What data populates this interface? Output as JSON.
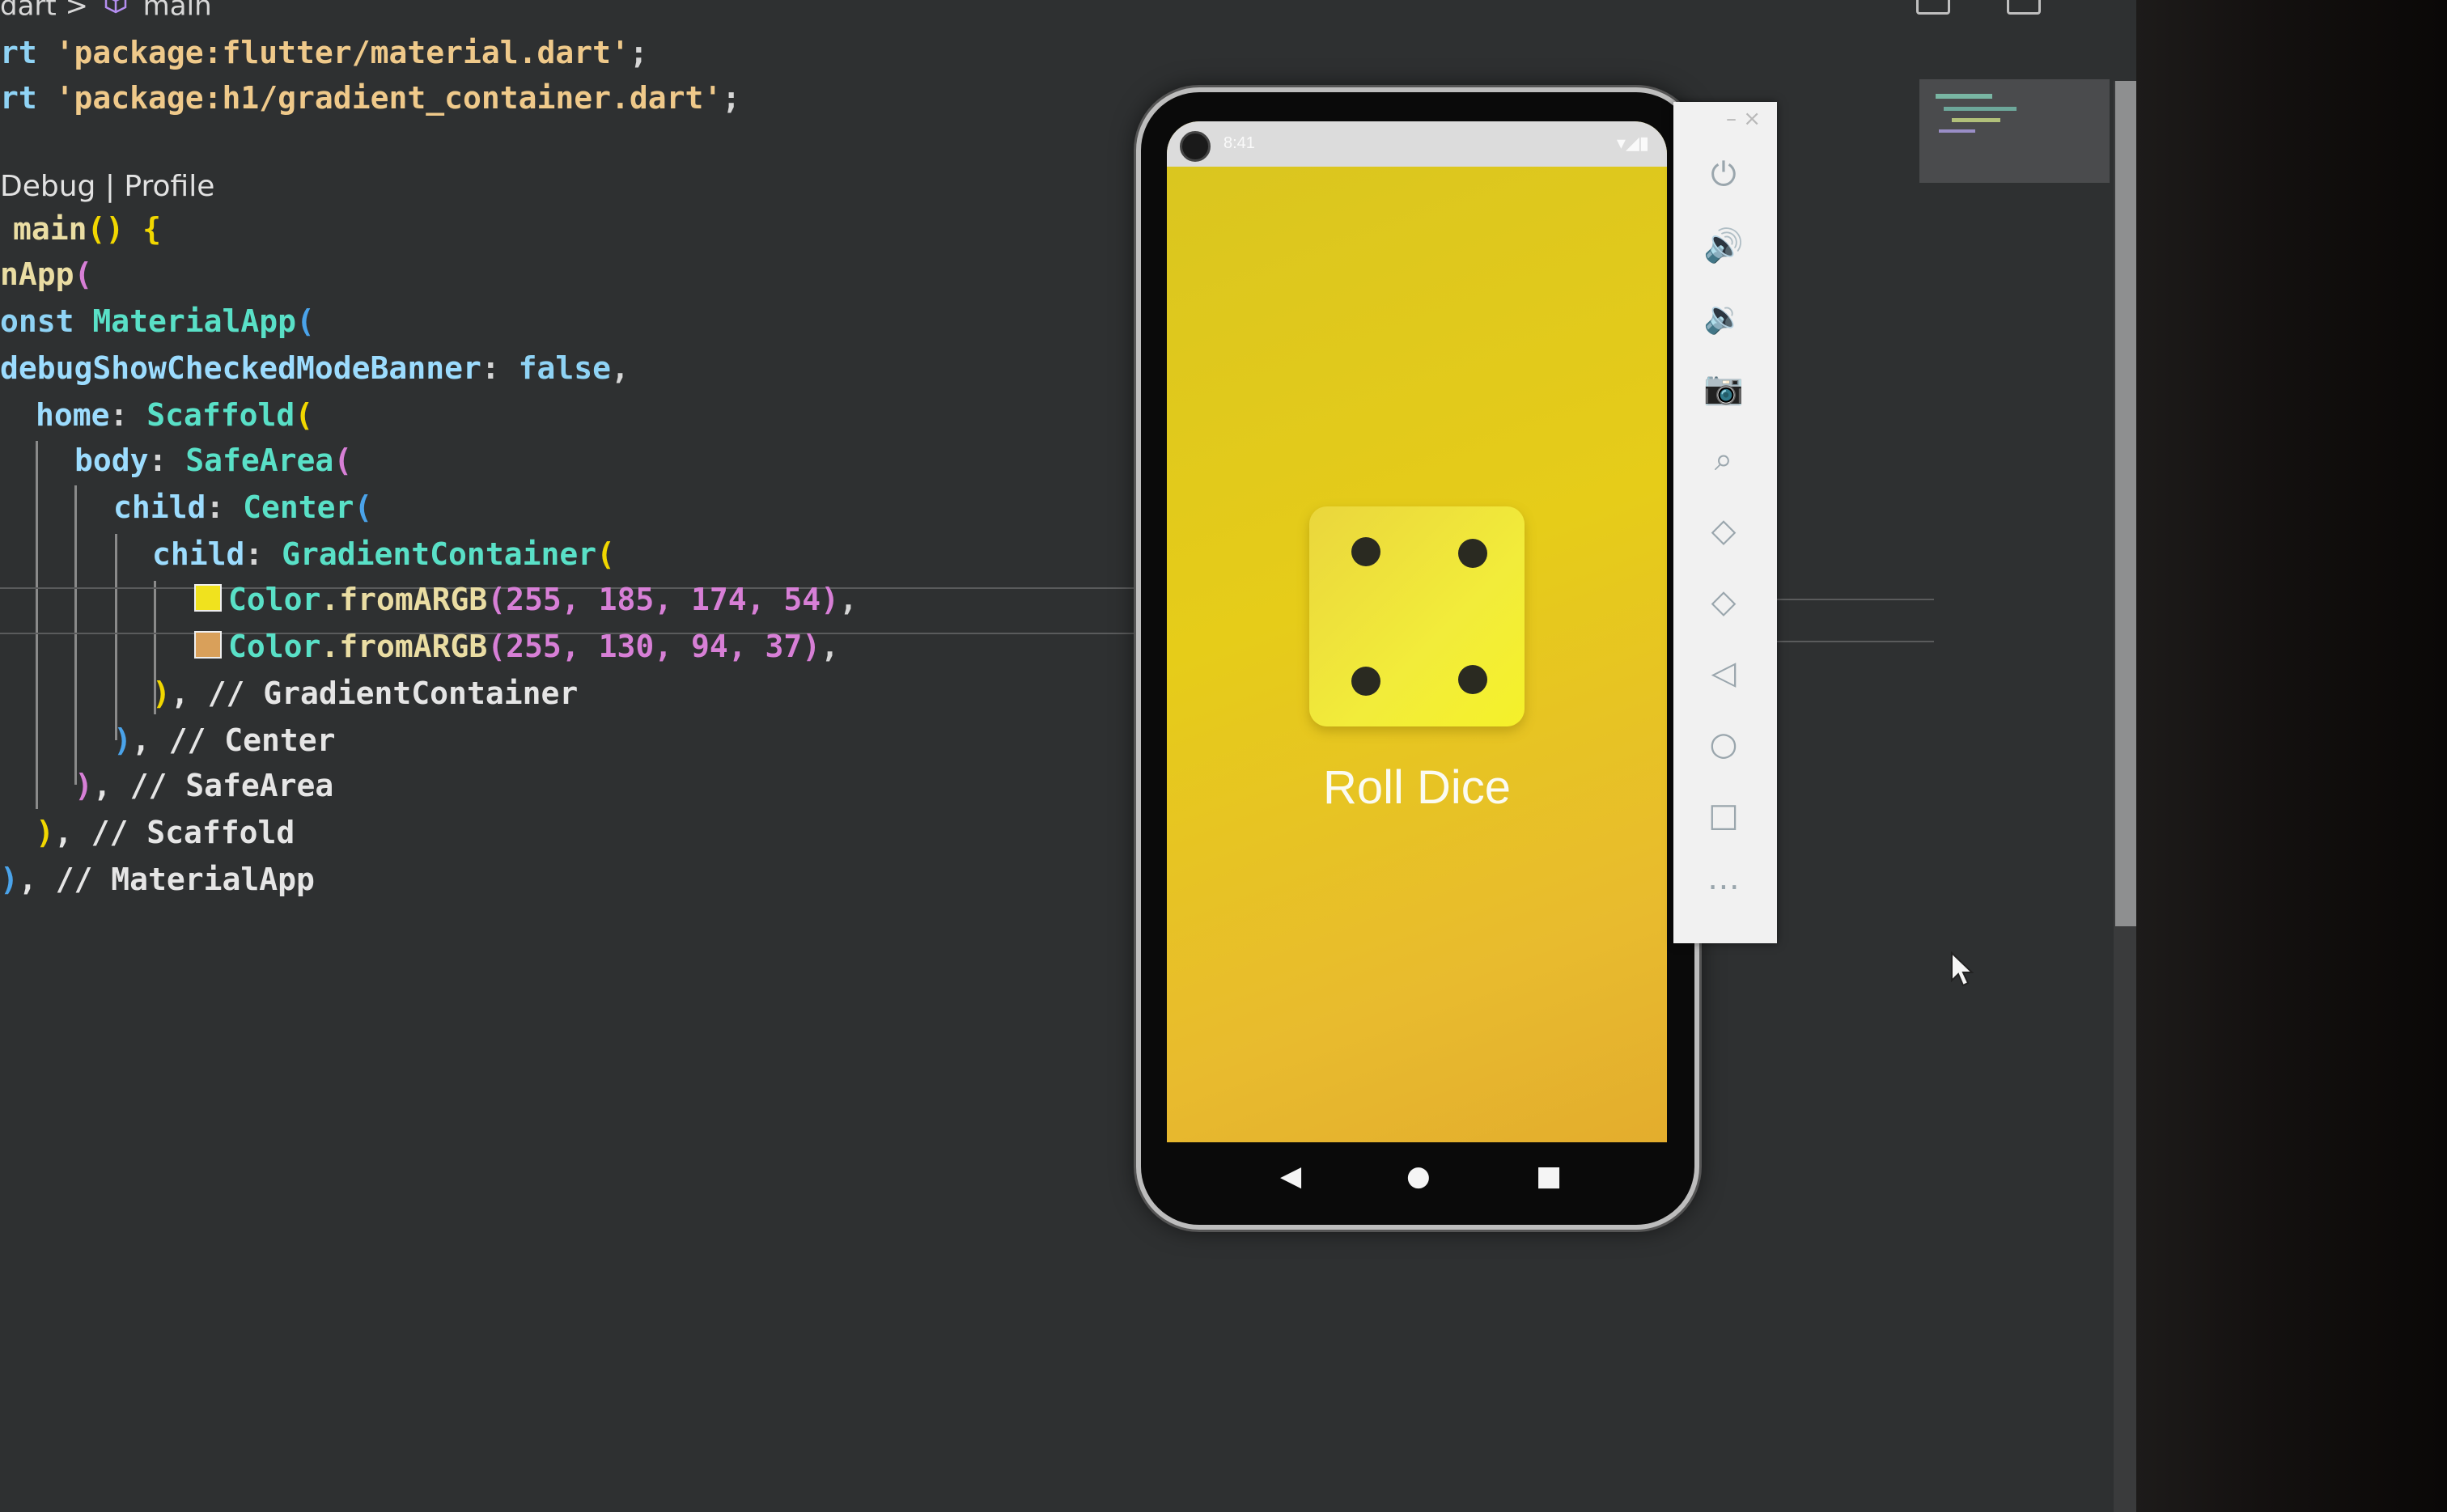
{
  "breadcrumb": {
    "folder": "dart",
    "separator": ">",
    "symbol": "main"
  },
  "code": {
    "l1": {
      "kw": "rt ",
      "str": "'package:flutter/material.dart'",
      "end": ";"
    },
    "l2": {
      "kw": "rt ",
      "str": "'package:h1/gradient_container.dart'",
      "end": ";"
    },
    "lens": "Debug | Profile",
    "l4": {
      "fn": "main",
      "paren": "()",
      "brace": " {"
    },
    "l5": {
      "fn": "nApp",
      "paren": "("
    },
    "l6": {
      "kw": "onst ",
      "cls": "MaterialApp",
      "paren": "("
    },
    "l7": {
      "prop": "debugShowCheckedModeBanner",
      "colon": ": ",
      "val": "false",
      "end": ","
    },
    "l8": {
      "prop": "home",
      "colon": ": ",
      "cls": "Scaffold",
      "paren": "("
    },
    "l9": {
      "prop": "body",
      "colon": ": ",
      "cls": "SafeArea",
      "paren": "("
    },
    "l10": {
      "prop": "child",
      "colon": ": ",
      "cls": "Center",
      "paren": "("
    },
    "l11": {
      "prop": "child",
      "colon": ": ",
      "cls": "GradientContainer",
      "paren": "("
    },
    "l12": {
      "cls": "Color",
      "fn": ".fromARGB",
      "args": "(255, 185, 174, 54)",
      "end": ","
    },
    "l13": {
      "cls": "Color",
      "fn": ".fromARGB",
      "args": "(255, 130, 94, 37)",
      "end": ","
    },
    "l14": {
      "close": ")",
      "comment": ", // GradientContainer"
    },
    "l15": {
      "close": ")",
      "comment": ", // Center"
    },
    "l16": {
      "close": ")",
      "comment": ", // SafeArea"
    },
    "l17": {
      "close": ")",
      "comment": ", // Scaffold"
    },
    "l18": {
      "close": ")",
      "comment": ", // MaterialApp"
    }
  },
  "swatches": {
    "color1": "#f0e21e",
    "color2": "#d9a05a"
  },
  "phone": {
    "status_time": "8:41",
    "status_icons": "▾◢▮",
    "button_label": "Roll Dice",
    "dice_value": 4,
    "nav": {
      "back": "◀",
      "home": "●",
      "recents": "■"
    }
  },
  "toolbar": {
    "window_controls": "– ×",
    "items": [
      {
        "name": "power-icon",
        "glyph": "⏻"
      },
      {
        "name": "volume-up-icon",
        "glyph": "🔊"
      },
      {
        "name": "volume-down-icon",
        "glyph": "🔉"
      },
      {
        "name": "camera-icon",
        "glyph": "📷"
      },
      {
        "name": "zoom-icon",
        "glyph": "⌕"
      },
      {
        "name": "rotate-left-icon",
        "glyph": "◇"
      },
      {
        "name": "rotate-right-icon",
        "glyph": "◇"
      },
      {
        "name": "back-icon",
        "glyph": "◁"
      },
      {
        "name": "home-icon",
        "glyph": "○"
      },
      {
        "name": "overview-icon",
        "glyph": "□"
      },
      {
        "name": "more-icon",
        "glyph": "⋯"
      }
    ]
  }
}
